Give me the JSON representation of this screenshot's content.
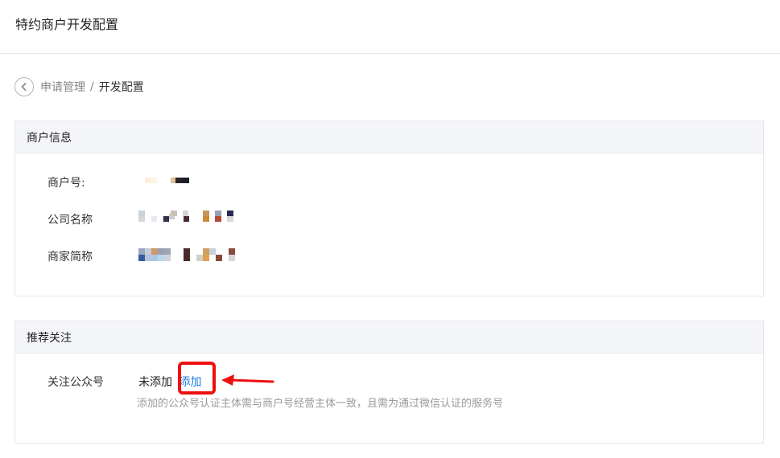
{
  "header": {
    "title": "特约商户开发配置"
  },
  "breadcrumb": {
    "parent": "申请管理",
    "separator": "/",
    "current": "开发配置"
  },
  "merchant_info": {
    "section_title": "商户信息",
    "merchant_id_label": "商户号:",
    "company_name_label": "公司名称",
    "store_name_label": "商家简称"
  },
  "recommend_follow": {
    "section_title": "推荐关注",
    "official_account_label": "关注公众号",
    "status": "未添加",
    "add_link": "添加",
    "hint": "添加的公众号认证主体需与商户号经营主体一致，且需为通过微信认证的服务号"
  },
  "colors": {
    "link": "#1e7de0",
    "annotation_red": "#ee1010"
  }
}
